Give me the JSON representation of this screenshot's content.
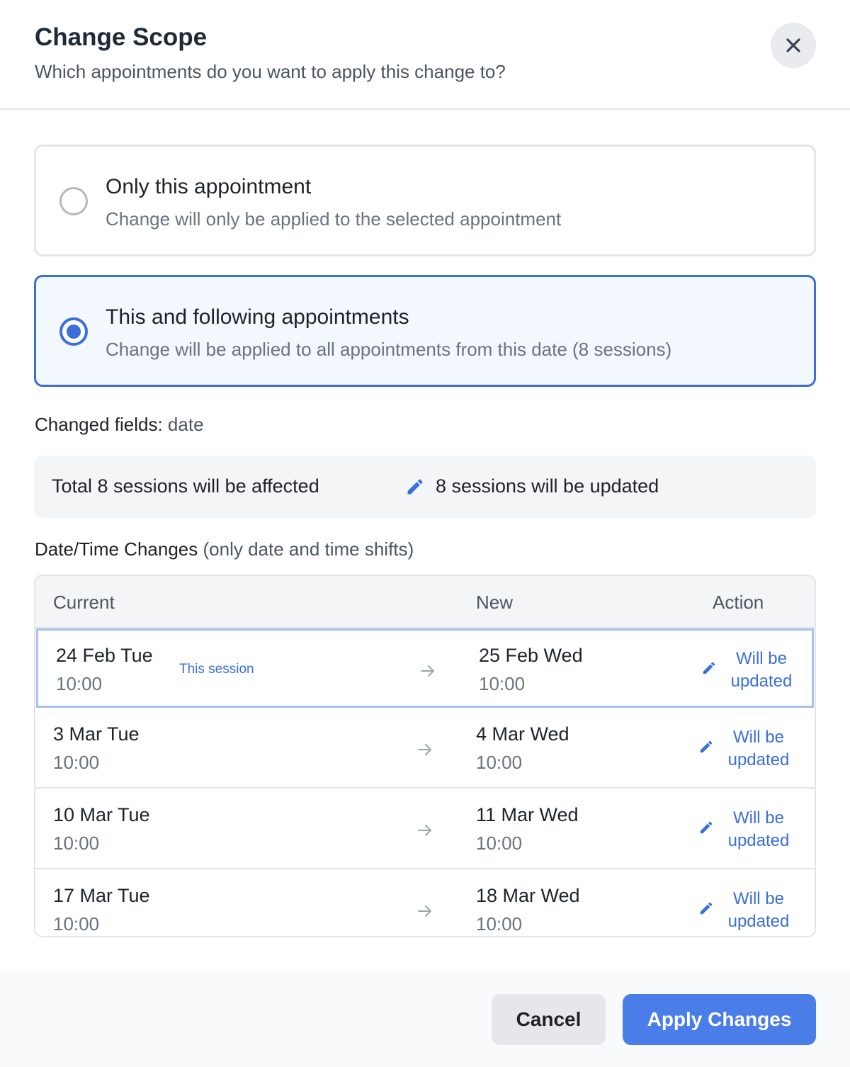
{
  "dialog": {
    "title": "Change Scope",
    "subtitle": "Which appointments do you want to apply this change to?"
  },
  "options": [
    {
      "title": "Only this appointment",
      "description": "Change will only be applied to the selected appointment",
      "selected": false
    },
    {
      "title": "This and following appointments",
      "description": "Change will be applied to all appointments from this date (8 sessions)",
      "selected": true
    }
  ],
  "changed_fields": {
    "label": "Changed fields:",
    "value": "date"
  },
  "summary": {
    "total": "Total 8 sessions will be affected",
    "updated": "8 sessions will be updated"
  },
  "datetime_section": {
    "title": "Date/Time Changes",
    "note": "(only date and time shifts)"
  },
  "table": {
    "headers": {
      "current": "Current",
      "new": "New",
      "action": "Action"
    },
    "rows": [
      {
        "current_date": "24 Feb Tue",
        "current_time": "10:00",
        "badge": "This session",
        "new_date": "25 Feb Wed",
        "new_time": "10:00",
        "action": "Will be updated"
      },
      {
        "current_date": "3 Mar Tue",
        "current_time": "10:00",
        "new_date": "4 Mar Wed",
        "new_time": "10:00",
        "action": "Will be updated"
      },
      {
        "current_date": "10 Mar Tue",
        "current_time": "10:00",
        "new_date": "11 Mar Wed",
        "new_time": "10:00",
        "action": "Will be updated"
      },
      {
        "current_date": "17 Mar Tue",
        "current_time": "10:00",
        "new_date": "18 Mar Wed",
        "new_time": "10:00",
        "action": "Will be updated"
      }
    ]
  },
  "footer": {
    "cancel": "Cancel",
    "apply": "Apply Changes"
  },
  "colors": {
    "accent": "#3b6fd9",
    "apply_button": "#4a7de8"
  }
}
